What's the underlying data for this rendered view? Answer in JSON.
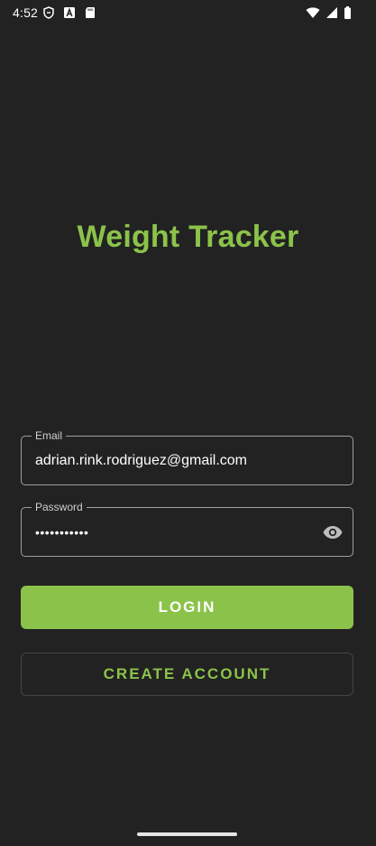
{
  "status_bar": {
    "time": "4:52",
    "left_icons": [
      "shield-icon",
      "a-badge-icon",
      "sd-card-icon"
    ],
    "right_icons": [
      "wifi-icon",
      "signal-icon",
      "battery-icon"
    ]
  },
  "app": {
    "title": "Weight Tracker",
    "accent_color": "#8bc34a",
    "background_color": "#222222"
  },
  "login_form": {
    "email": {
      "label": "Email",
      "value": "adrian.rink.rodriguez@gmail.com"
    },
    "password": {
      "label": "Password",
      "value": "•••••••••••",
      "toggle_icon": "eye-icon"
    },
    "login_label": "LOGIN",
    "create_account_label": "CREATE ACCOUNT"
  }
}
